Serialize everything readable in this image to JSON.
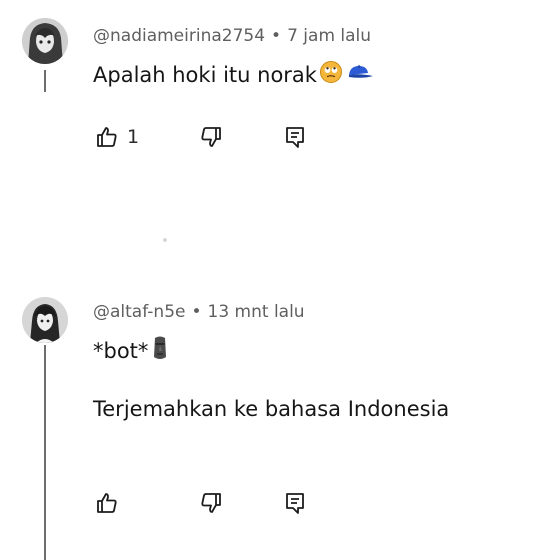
{
  "comments": [
    {
      "username": "@nadiameirina2754",
      "separator": "•",
      "time": "7 jam lalu",
      "text": "Apalah hoki itu norak",
      "emojis": [
        "rolling-eyes-face-icon",
        "blue-cap-icon"
      ],
      "like_count": "1"
    },
    {
      "username": "@altaf-n5e",
      "separator": "•",
      "time": "13 mnt lalu",
      "text": "*bot*",
      "emojis": [
        "moai-icon"
      ],
      "translate_link": "Terjemahkan ke bahasa Indonesia",
      "like_count": ""
    }
  ],
  "colors": {
    "meta_text": "#5f5f5f",
    "body_text": "#161616",
    "thread_line": "#6d6d6d",
    "emoji_face": "#f4b73c",
    "cap": "#2d5bd6"
  }
}
